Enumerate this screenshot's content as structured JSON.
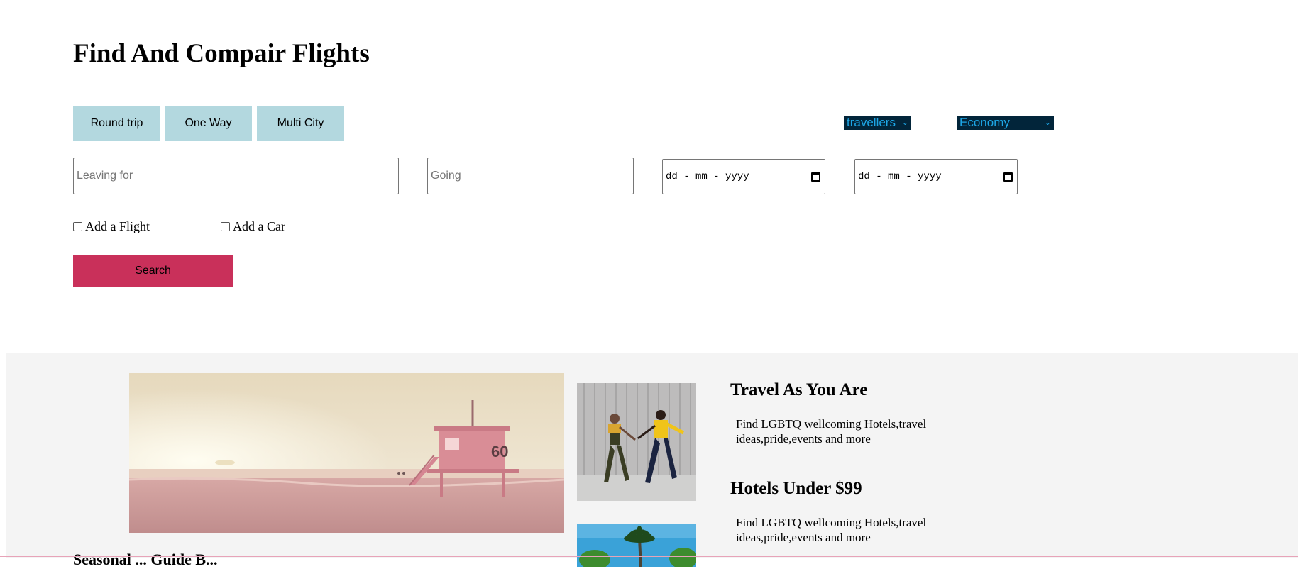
{
  "page": {
    "title": "Find And Compair Flights"
  },
  "trip_tabs": [
    {
      "label": "Round trip"
    },
    {
      "label": "One Way"
    },
    {
      "label": "Multi City"
    }
  ],
  "selects": {
    "travellers": {
      "value": "travellers"
    },
    "cabin": {
      "value": "Economy"
    }
  },
  "form": {
    "leaving": {
      "placeholder": "Leaving for"
    },
    "going": {
      "placeholder": "Going"
    },
    "depart_date": {
      "value": "dd - mm - yyyy"
    },
    "return_date": {
      "value": "dd - mm - yyyy"
    },
    "add_flight": {
      "label": "Add a Flight",
      "checked": false
    },
    "add_car": {
      "label": "Add a Car",
      "checked": false
    },
    "search_label": "Search"
  },
  "promo": {
    "cards": [
      {
        "heading": "Travel As You Are",
        "text": "Find LGBTQ wellcoming Hotels,travel ideas,pride,events and more"
      },
      {
        "heading": "Hotels Under $99",
        "text": "Find LGBTQ wellcoming Hotels,travel ideas,pride,events and more"
      }
    ],
    "partial_heading": "Seasonal ... Guide B..."
  },
  "colors": {
    "tab_bg": "#b3d8df",
    "search_bg": "#c9305a",
    "select_bg": "#02253a",
    "select_text": "#1da6e6",
    "band_bg": "#f4f4f4"
  },
  "icons": [
    "chevron-down-icon",
    "calendar-icon",
    "checkbox"
  ]
}
